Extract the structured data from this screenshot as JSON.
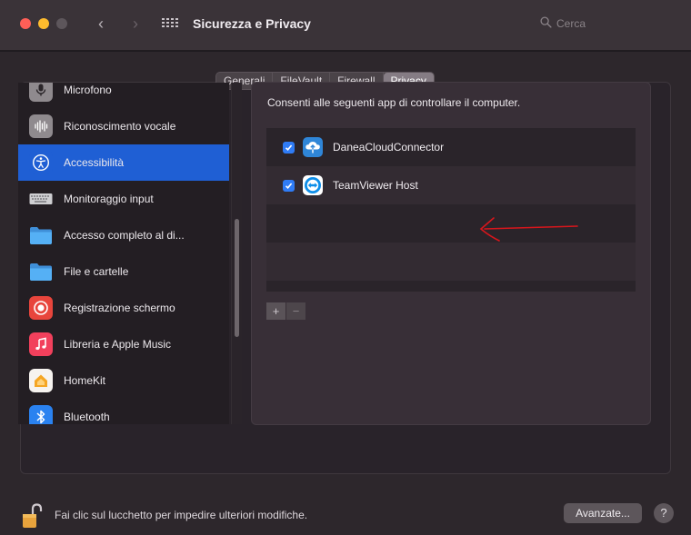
{
  "window": {
    "title": "Sicurezza e Privacy",
    "search_placeholder": "Cerca"
  },
  "tabs": [
    {
      "label": "Generali",
      "active": false
    },
    {
      "label": "FileVault",
      "active": false
    },
    {
      "label": "Firewall",
      "active": false
    },
    {
      "label": "Privacy",
      "active": true
    }
  ],
  "sidebar": {
    "items": [
      {
        "label": "Microfono",
        "icon": "microphone-icon",
        "color": "#8f8a8e"
      },
      {
        "label": "Riconoscimento vocale",
        "icon": "waveform-icon",
        "color": "#8f8a8e"
      },
      {
        "label": "Accessibilità",
        "icon": "accessibility-icon",
        "color": "#1f5fd4",
        "active": true
      },
      {
        "label": "Monitoraggio input",
        "icon": "keyboard-icon",
        "color": "#cfcfd2"
      },
      {
        "label": "Accesso completo al di...",
        "icon": "folder-icon",
        "color": "#49a6f0"
      },
      {
        "label": "File e cartelle",
        "icon": "folder-icon",
        "color": "#49a6f0"
      },
      {
        "label": "Registrazione schermo",
        "icon": "screen-record-icon",
        "color": "#e8453c"
      },
      {
        "label": "Libreria e Apple Music",
        "icon": "music-icon",
        "color": "#f2405c"
      },
      {
        "label": "HomeKit",
        "icon": "home-icon",
        "color": "#f6f3ef"
      },
      {
        "label": "Bluetooth",
        "icon": "bluetooth-icon",
        "color": "#2a82f0"
      }
    ]
  },
  "pane": {
    "title": "Consenti alle seguenti app di controllare il computer.",
    "apps": [
      {
        "name": "DaneaCloudConnector",
        "checked": true,
        "icon": "cloud-connector-icon"
      },
      {
        "name": "TeamViewer Host",
        "checked": true,
        "icon": "teamviewer-icon"
      }
    ],
    "add_label": "+",
    "remove_label": "−"
  },
  "footer": {
    "lock_text": "Fai clic sul lucchetto per impedire ulteriori modifiche.",
    "advanced_label": "Avanzate...",
    "help_label": "?"
  },
  "colors": {
    "accent": "#1f5fd4",
    "checkbox": "#2f7cf6",
    "annotation_arrow": "#d8161c"
  }
}
